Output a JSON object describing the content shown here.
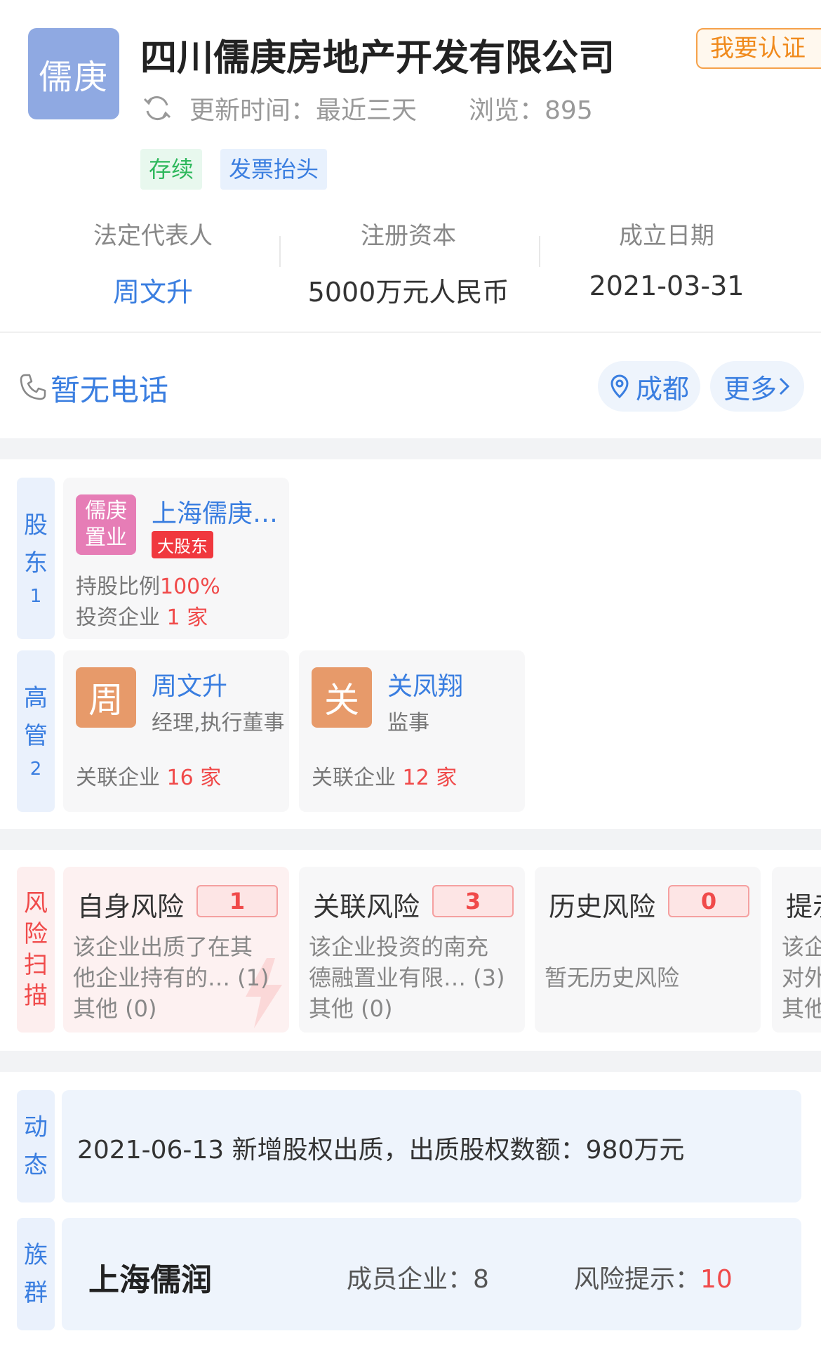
{
  "header": {
    "logo_text": "儒庚",
    "company_name": "四川儒庚房地产开发有限公司",
    "cert_button": "我要认证",
    "update_label": "更新时间：最近三天",
    "views_label": "浏览：895",
    "tags": [
      "存续",
      "发票抬头"
    ]
  },
  "basic_info": [
    {
      "label": "法定代表人",
      "value": "周文升"
    },
    {
      "label": "注册资本",
      "value": "5000万元人民币"
    },
    {
      "label": "成立日期",
      "value": "2021-03-31"
    }
  ],
  "contact": {
    "phone": "暂无电话",
    "city": "成都",
    "more": "更多"
  },
  "shareholders": {
    "tab_label": [
      "股",
      "东"
    ],
    "count": "1",
    "items": [
      {
        "avatar_line1": "儒庚",
        "avatar_line2": "置业",
        "name": "上海儒庚…",
        "badge": "大股东",
        "ratio_label": "持股比例",
        "ratio_value": "100%",
        "invest_label": "投资企业",
        "invest_count": "1",
        "invest_unit": "家"
      }
    ]
  },
  "executives": {
    "tab_label": [
      "高",
      "管"
    ],
    "count": "2",
    "items": [
      {
        "avatar": "周",
        "name": "周文升",
        "role": "经理,执行董事",
        "rel_label": "关联企业",
        "rel_count": "16",
        "rel_unit": "家"
      },
      {
        "avatar": "关",
        "name": "关凤翔",
        "role": "监事",
        "rel_label": "关联企业",
        "rel_count": "12",
        "rel_unit": "家"
      }
    ]
  },
  "risk_scan": {
    "tab_label": [
      "风",
      "险",
      "扫",
      "描"
    ],
    "items": [
      {
        "title": "自身风险",
        "count": "1",
        "lines": [
          "该企业出质了在其",
          "他企业持有的… (1)",
          "其他 (0)"
        ]
      },
      {
        "title": "关联风险",
        "count": "3",
        "lines": [
          "该企业投资的南充",
          "德融置业有限… (3)",
          "其他 (0)"
        ]
      },
      {
        "title": "历史风险",
        "count": "0",
        "lines": [
          "暂无历史风险"
        ]
      },
      {
        "title": "提示",
        "lines": [
          "该企",
          "对外",
          "其他"
        ]
      }
    ]
  },
  "dynamics": {
    "tab_label": [
      "动",
      "态"
    ],
    "text": "2021-06-13 新增股权出质，出质股权数额：980万元"
  },
  "group": {
    "tab_label": [
      "族",
      "群"
    ],
    "name": "上海儒润",
    "members_label": "成员企业：",
    "members_value": "8",
    "risk_label": "风险提示：",
    "risk_value": "10"
  },
  "colors": {
    "link_blue": "#3a7ee0",
    "alert_red": "#f04a4a",
    "cert_orange": "#f08a1c",
    "status_green": "#2eb85c"
  }
}
